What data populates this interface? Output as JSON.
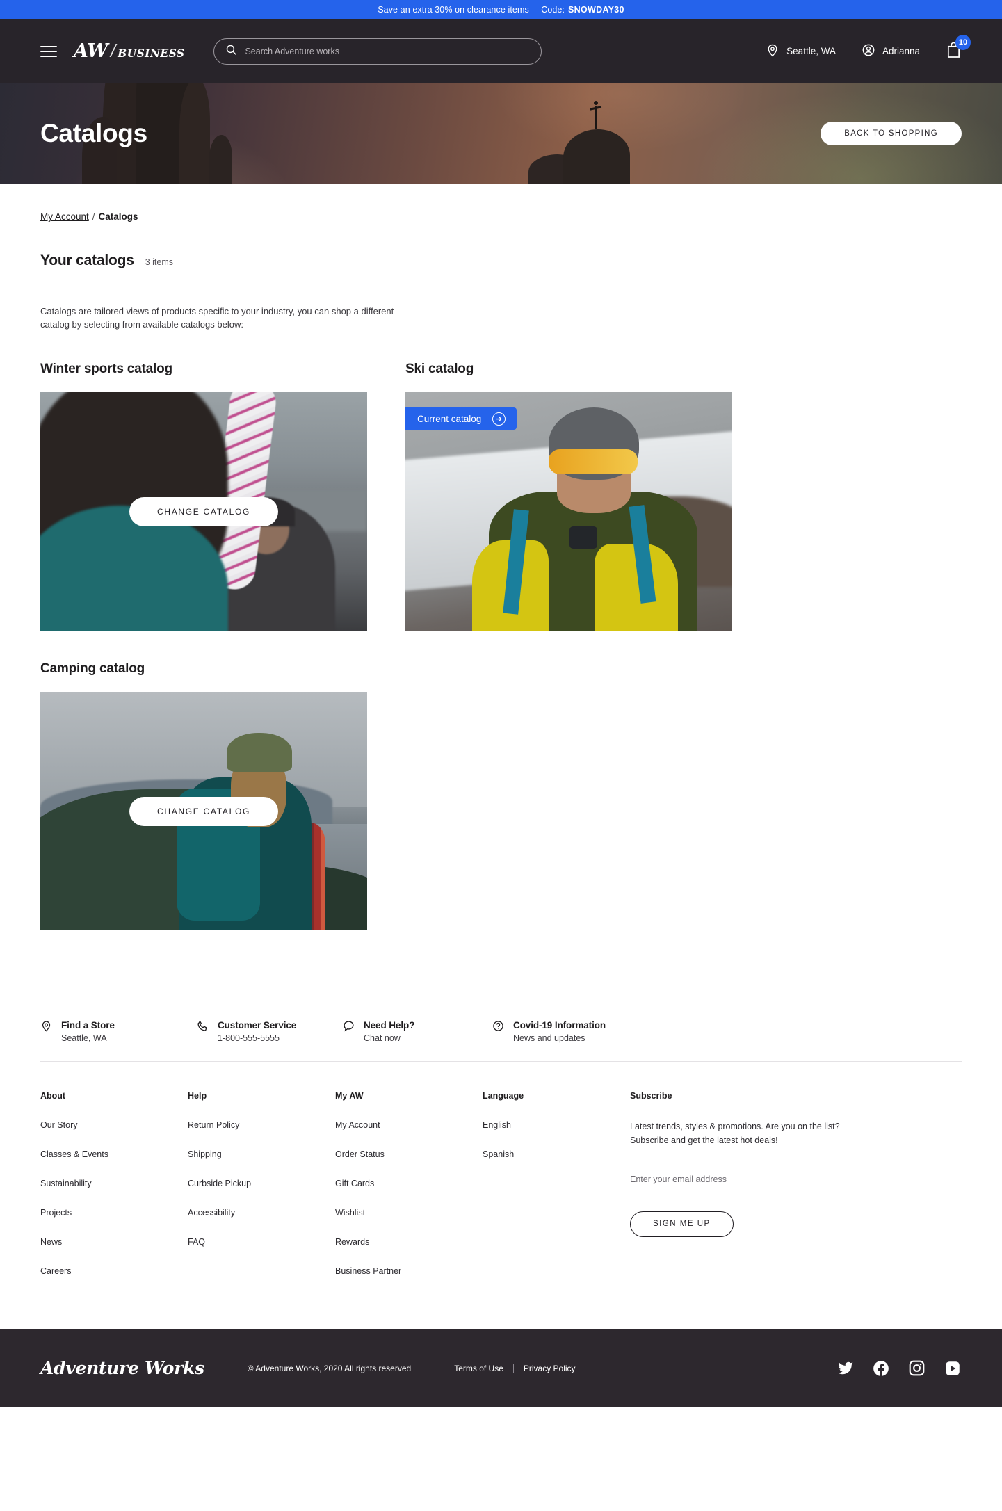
{
  "promo": {
    "text": "Save an extra 30% on clearance items",
    "separator": "|",
    "code_label": "Code:",
    "code": "SNOWDAY30",
    "bg_color": "#2563eb"
  },
  "header": {
    "menu_icon": "hamburger-icon",
    "logo_main": "AW",
    "logo_slash": "/",
    "logo_sub": "BUSINESS",
    "search_placeholder": "Search Adventure works",
    "search_value": "",
    "location": "Seattle, WA",
    "account": "Adrianna",
    "cart_count": "10",
    "bg_color": "#28242a"
  },
  "hero": {
    "title": "Catalogs",
    "button": "BACK TO SHOPPING"
  },
  "breadcrumb": {
    "parent": "My Account",
    "separator": "/",
    "current": "Catalogs"
  },
  "section": {
    "title": "Your catalogs",
    "count": "3 items",
    "intro": "Catalogs are tailored views of products specific to your industry, you can shop a different catalog by selecting from available catalogs below:"
  },
  "catalogs": [
    {
      "title": "Winter sports catalog",
      "action": "CHANGE CATALOG",
      "is_current": false,
      "badge": ""
    },
    {
      "title": "Ski catalog",
      "action": "",
      "is_current": true,
      "badge": "Current catalog"
    },
    {
      "title": "Camping catalog",
      "action": "CHANGE CATALOG",
      "is_current": false,
      "badge": ""
    }
  ],
  "services": [
    {
      "icon": "location-pin-icon",
      "title": "Find a Store",
      "subtitle": "Seattle, WA"
    },
    {
      "icon": "phone-icon",
      "title": "Customer Service",
      "subtitle": "1-800-555-5555"
    },
    {
      "icon": "chat-bubble-icon",
      "title": "Need Help?",
      "subtitle": "Chat now"
    },
    {
      "icon": "question-circle-icon",
      "title": "Covid-19 Information",
      "subtitle": "News and updates"
    }
  ],
  "footer": {
    "columns": [
      {
        "heading": "About",
        "links": [
          "Our Story",
          "Classes & Events",
          "Sustainability",
          "Projects",
          "News",
          "Careers"
        ]
      },
      {
        "heading": "Help",
        "links": [
          "Return Policy",
          "Shipping",
          "Curbside Pickup",
          "Accessibility",
          "FAQ"
        ]
      },
      {
        "heading": "My AW",
        "links": [
          "My Account",
          "Order Status",
          "Gift Cards",
          "Wishlist",
          "Rewards",
          "Business Partner"
        ]
      },
      {
        "heading": "Language",
        "links": [
          "English",
          "Spanish"
        ]
      }
    ],
    "subscribe": {
      "heading": "Subscribe",
      "line1": "Latest trends, styles & promotions. Are you on the list?",
      "line2": "Subscribe and get the latest hot deals!",
      "placeholder": "Enter your email address",
      "value": "",
      "button": "SIGN ME UP"
    }
  },
  "bottom": {
    "wordmark": "Adventure Works",
    "copyright": "© Adventure Works, 2020 All rights reserved",
    "terms": "Terms of Use",
    "privacy": "Privacy Policy",
    "socials": [
      "twitter-icon",
      "facebook-icon",
      "instagram-icon",
      "youtube-icon"
    ]
  }
}
